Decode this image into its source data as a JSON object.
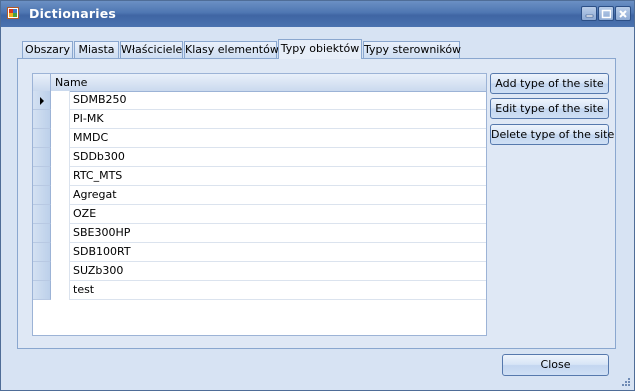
{
  "window": {
    "title": "Dictionaries"
  },
  "colors": {
    "titlebar": "#4e76b2",
    "background": "#d7e3f3",
    "selected_row": "#bcd0ea"
  },
  "icons": {
    "app": "app-icon",
    "minimize": "minimize-icon",
    "maximize": "maximize-icon",
    "close": "close-icon"
  },
  "tabs": [
    {
      "label": "Obszary"
    },
    {
      "label": "Miasta"
    },
    {
      "label": "Właściciele"
    },
    {
      "label": "Klasy elementów"
    },
    {
      "label": "Typy obiektów",
      "active": true
    },
    {
      "label": "Typy sterowników"
    }
  ],
  "grid": {
    "column_header": "Name",
    "rows": [
      "SDMB250",
      "PI-MK",
      "MMDC",
      "SDDb300",
      "RTC_MTS",
      "Agregat",
      "OZE",
      "SBE300HP",
      "SDB100RT",
      "SUZb300",
      "test"
    ],
    "selected_index": 0
  },
  "buttons": {
    "add": "Add type of the site",
    "edit": "Edit type of the site",
    "delete": "Delete type of the site",
    "close": "Close"
  }
}
